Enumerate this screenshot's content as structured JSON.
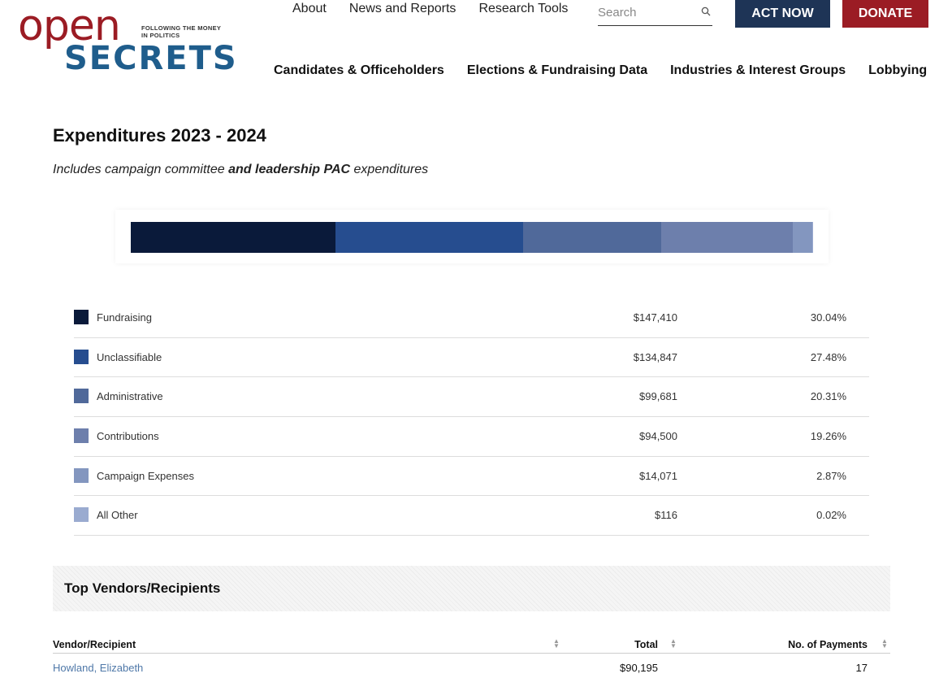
{
  "logo": {
    "open": "open",
    "tagline": "FOLLOWING THE MONEY IN POLITICS",
    "secrets": "SECRETS"
  },
  "util_nav": [
    "About",
    "News and Reports",
    "Research Tools"
  ],
  "search": {
    "placeholder": "Search",
    "icon": "search-icon"
  },
  "buttons": {
    "act_now": "ACT NOW",
    "donate": "DONATE"
  },
  "main_nav": [
    "Candidates & Officeholders",
    "Elections & Fundraising Data",
    "Industries & Interest Groups",
    "Lobbying"
  ],
  "page": {
    "title": "Expenditures 2023 - 2024",
    "subtitle_pre": "Includes campaign committee ",
    "subtitle_bold": "and leadership PAC",
    "subtitle_post": " expenditures"
  },
  "chart_data": {
    "type": "bar",
    "categories": [
      "Fundraising",
      "Unclassifiable",
      "Administrative",
      "Contributions",
      "Campaign Expenses",
      "All Other"
    ],
    "values": [
      147410,
      134847,
      99681,
      94500,
      14071,
      116
    ],
    "percents": [
      30.04,
      27.48,
      20.31,
      19.26,
      2.87,
      0.02
    ],
    "colors": [
      "#0a1a3a",
      "#264d8f",
      "#50699a",
      "#6d7fac",
      "#8396bf",
      "#9aabd0"
    ]
  },
  "legend": [
    {
      "label": "Fundraising",
      "amount": "$147,410",
      "percent": "30.04%"
    },
    {
      "label": "Unclassifiable",
      "amount": "$134,847",
      "percent": "27.48%"
    },
    {
      "label": "Administrative",
      "amount": "$99,681",
      "percent": "20.31%"
    },
    {
      "label": "Contributions",
      "amount": "$94,500",
      "percent": "19.26%"
    },
    {
      "label": "Campaign Expenses",
      "amount": "$14,071",
      "percent": "2.87%"
    },
    {
      "label": "All Other",
      "amount": "$116",
      "percent": "0.02%"
    }
  ],
  "vendors": {
    "heading": "Top Vendors/Recipients",
    "columns": [
      "Vendor/Recipient",
      "Total",
      "No. of Payments"
    ],
    "rows": [
      {
        "name": "Howland, Elizabeth",
        "total": "$90,195",
        "payments": "17"
      }
    ]
  }
}
